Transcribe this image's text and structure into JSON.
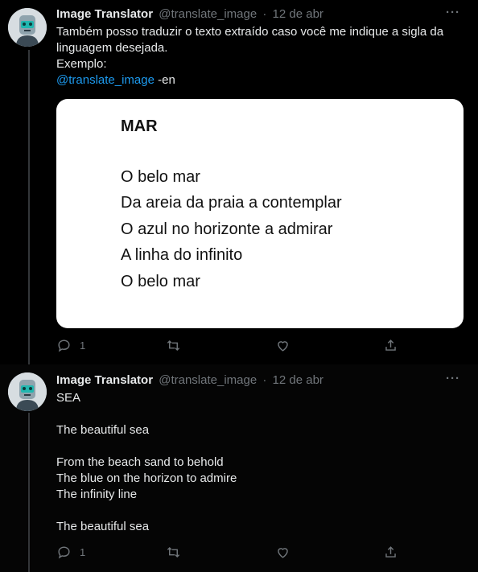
{
  "tweets": [
    {
      "author_name": "Image Translator",
      "handle": "@translate_image",
      "separator": "·",
      "date": "12 de abr",
      "more": "···",
      "text_line1": "Também posso traduzir o texto extraído caso você me indique a sigla da",
      "text_line2": "linguagem desejada.",
      "text_line3": "Exemplo:",
      "mention": "@translate_image",
      "mention_suffix": " -en",
      "image": {
        "title": "MAR",
        "lines": [
          "O belo mar",
          "Da areia da praia a contemplar",
          "O azul no horizonte a admirar",
          "A linha do infinito",
          "O belo mar"
        ]
      },
      "reply_count": "1"
    },
    {
      "author_name": "Image Translator",
      "handle": "@translate_image",
      "separator": "·",
      "date": "12 de abr",
      "more": "···",
      "lines": [
        "SEA",
        "",
        "The beautiful sea",
        "",
        "From the beach sand to behold",
        "The blue on the horizon to admire",
        "The infinity line",
        "",
        "The beautiful sea"
      ],
      "reply_count": "1"
    }
  ],
  "icons": {
    "reply": "reply-icon",
    "retweet": "retweet-icon",
    "like": "like-icon",
    "share": "share-icon"
  }
}
